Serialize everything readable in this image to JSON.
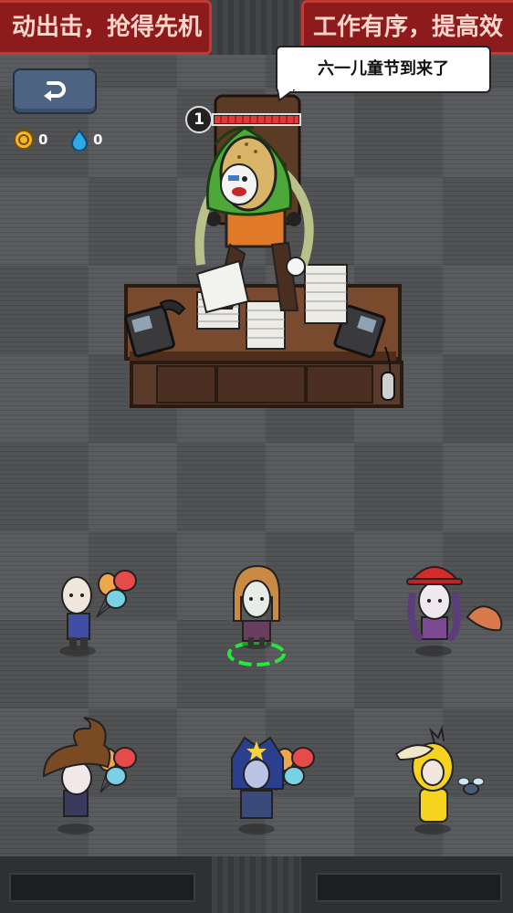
{
  "banners": {
    "left_text": "动出击，抢得先机",
    "right_text": "工作有序，提高效"
  },
  "hud": {
    "back_icon": "return-arrow-icon",
    "coin_icon": "gold-coin-icon",
    "coin_count": "0",
    "water_icon": "water-drop-icon",
    "water_count": "0"
  },
  "boss": {
    "speech": "六一儿童节到来了",
    "level": "1",
    "health_fraction": 1.0
  },
  "colors": {
    "banner_red": "#8e1b1b",
    "floor_gray": "#5a5b5e",
    "health_red": "#e23a3a",
    "select_ring": "#27e83a"
  },
  "characters": [
    {
      "name": "bald-man-with-balloons",
      "selected": false
    },
    {
      "name": "girl-with-ponytails",
      "selected": true
    },
    {
      "name": "girl-with-fire-helmet",
      "selected": false
    },
    {
      "name": "girl-with-poop-hat",
      "selected": false
    },
    {
      "name": "hero-mask-with-balloons",
      "selected": false
    },
    {
      "name": "duck-costume",
      "selected": false
    }
  ]
}
